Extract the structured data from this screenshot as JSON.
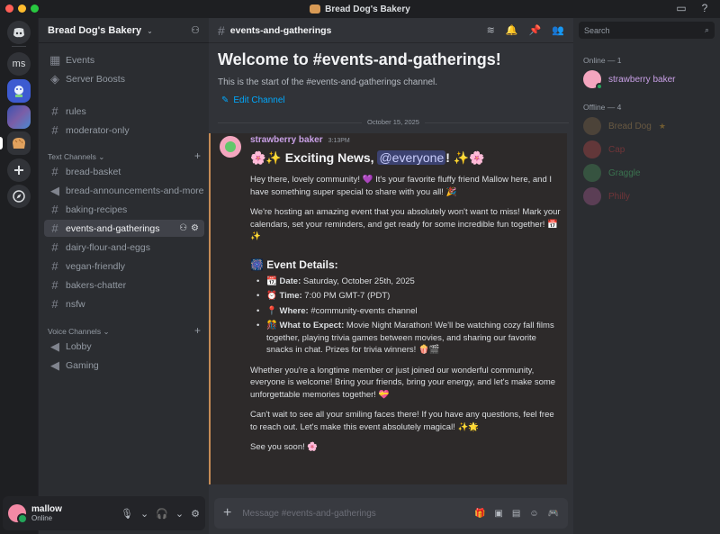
{
  "window": {
    "title": "Bread Dog's Bakery"
  },
  "guilds": {
    "ms_label": "ms"
  },
  "server": {
    "name": "Bread Dog's Bakery"
  },
  "sidebar": {
    "top_items": [
      {
        "label": "Events",
        "icon": "calendar-icon"
      },
      {
        "label": "Server Boosts",
        "icon": "boost-icon"
      }
    ],
    "loose_channels": [
      "rules",
      "moderator-only"
    ],
    "text_category": "Text Channels",
    "text_channels": [
      "bread-basket",
      "bread-announcements-and-more",
      "baking-recipes",
      "events-and-gatherings",
      "dairy-flour-and-eggs",
      "vegan-friendly",
      "bakers-chatter",
      "nsfw"
    ],
    "voice_category": "Voice Channels",
    "voice_channels": [
      "Lobby",
      "Gaming"
    ]
  },
  "user": {
    "name": "mallow",
    "status": "Online"
  },
  "channel": {
    "name": "events-and-gatherings",
    "welcome_title": "Welcome to #events-and-gatherings!",
    "welcome_sub": "This is the start of the #events-and-gatherings channel.",
    "edit_label": "Edit Channel",
    "date_divider": "October 15, 2025"
  },
  "message": {
    "author": "strawberry baker",
    "time": "3:13PM",
    "title_pre": "🌸✨ Exciting News, ",
    "title_mention": "@everyone",
    "title_post": "! ✨🌸",
    "p1": "Hey there, lovely community! 💜 It's your favorite fluffy friend Mallow here, and I have something super special to share with you all! 🎉",
    "p2": "We're hosting an amazing event that you absolutely won't want to miss! Mark your calendars, set your reminders, and get ready for some incredible fun together! 📅✨",
    "details_title": "🎆 Event Details:",
    "details": [
      {
        "label": "Date:",
        "value": "Saturday, October 25th, 2025",
        "emoji": "📆"
      },
      {
        "label": "Time:",
        "value": "7:00 PM GMT-7 (PDT)",
        "emoji": "⏰"
      },
      {
        "label": "Where:",
        "value": "#community-events channel",
        "emoji": "📍"
      },
      {
        "label": "What to Expect:",
        "value": "Movie Night Marathon! We'll be watching cozy fall films together, playing trivia games between movies, and sharing our favorite snacks in chat. Prizes for trivia winners! 🍿🎬",
        "emoji": "🎊"
      }
    ],
    "p3": "Whether you're a longtime member or just joined our wonderful community, everyone is welcome! Bring your friends, bring your energy, and let's make some unforgettable memories together! 💝",
    "p4": "Can't wait to see all your smiling faces there! If you have any questions, feel free to reach out. Let's make this event absolutely magical! ✨🌟",
    "p5": "See you soon! 🌸"
  },
  "composer": {
    "placeholder": "Message #events-and-gatherings"
  },
  "members": {
    "search_placeholder": "Search",
    "online_label": "Online — 1",
    "offline_label": "Offline — 4",
    "online": [
      {
        "name": "strawberry baker",
        "color": "#c9a0e6"
      }
    ],
    "offline": [
      {
        "name": "Bread Dog",
        "color": "#d7a860"
      },
      {
        "name": "Cap",
        "color": "#ed4245"
      },
      {
        "name": "Graggle",
        "color": "#57f287"
      },
      {
        "name": "Philly",
        "color": "#ed4245"
      }
    ]
  }
}
